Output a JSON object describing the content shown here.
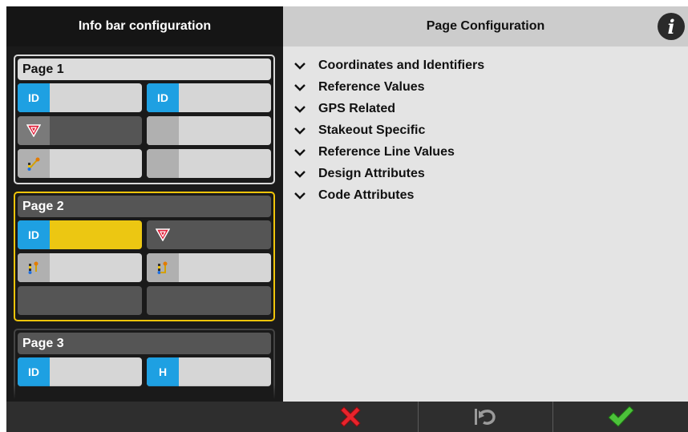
{
  "left_panel": {
    "title": "Info bar configuration",
    "pages": [
      {
        "title": "Page 1",
        "slots": [
          {
            "tag": "ID"
          },
          {
            "tag": "ID"
          },
          {
            "tag": ""
          },
          {
            "tag": ""
          },
          {
            "tag": ""
          },
          {
            "tag": ""
          }
        ]
      },
      {
        "title": "Page 2",
        "slots": [
          {
            "tag": "ID"
          },
          {
            "tag": ""
          },
          {
            "tag": ""
          },
          {
            "tag": ""
          },
          {
            "tag": ""
          },
          {
            "tag": ""
          }
        ]
      },
      {
        "title": "Page 3",
        "slots": [
          {
            "tag": "ID"
          },
          {
            "tag": "H"
          }
        ]
      }
    ]
  },
  "right_panel": {
    "title": "Page Configuration",
    "info_label": "i",
    "sections": [
      "Coordinates and Identifiers",
      "Reference Values",
      "GPS Related",
      "Stakeout Specific",
      "Reference Line Values",
      "Design Attributes",
      "Code Attributes"
    ]
  },
  "footer": {
    "cancel_icon": "red-x-icon",
    "undo_icon": "undo-icon",
    "confirm_icon": "green-check-icon"
  },
  "colors": {
    "selected_border": "#f0c40a",
    "id_tag": "#1ea0e2",
    "selected_slot": "#ecc712"
  }
}
